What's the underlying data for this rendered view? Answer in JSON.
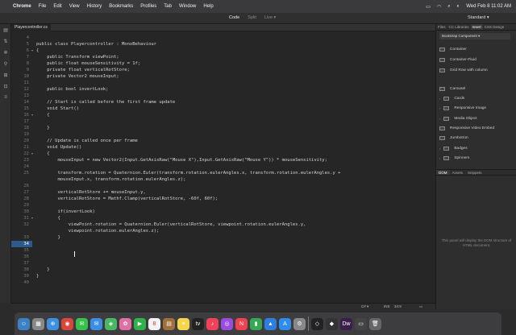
{
  "menubar": {
    "app_name": "Chrome",
    "items": [
      "File",
      "Edit",
      "View",
      "History",
      "Bookmarks",
      "Profiles",
      "Tab",
      "Window",
      "Help"
    ],
    "clock": "Wed Feb 8  11:02 AM"
  },
  "toolbar": {
    "tabs": [
      {
        "label": "Code",
        "active": true
      },
      {
        "label": "Split",
        "active": false
      },
      {
        "label": "Live ▾",
        "active": false
      }
    ],
    "workspace": "Standard ▾"
  },
  "editor": {
    "file_tab": "Playercontroller.cs",
    "current_line": "34",
    "lines": [
      {
        "n": "4",
        "fold": false,
        "t": ""
      },
      {
        "n": "5",
        "fold": false,
        "t": "public class Playercontroller : MonoBehaviour"
      },
      {
        "n": "6",
        "fold": true,
        "t": "{"
      },
      {
        "n": "7",
        "fold": false,
        "t": "    public Transform viewPoint;"
      },
      {
        "n": "8",
        "fold": false,
        "t": "    public float mouseSensitivity = 1f;"
      },
      {
        "n": "9",
        "fold": false,
        "t": "    private float verticalRotStore;"
      },
      {
        "n": "10",
        "fold": false,
        "t": "    private Vector2 mouseInput;"
      },
      {
        "n": "11",
        "fold": false,
        "t": ""
      },
      {
        "n": "12",
        "fold": false,
        "t": "    public bool invertLook;"
      },
      {
        "n": "13",
        "fold": false,
        "t": ""
      },
      {
        "n": "14",
        "fold": false,
        "t": "    // Start is called before the first frame update"
      },
      {
        "n": "15",
        "fold": false,
        "t": "    void Start()"
      },
      {
        "n": "16",
        "fold": true,
        "t": "    {"
      },
      {
        "n": "17",
        "fold": false,
        "t": ""
      },
      {
        "n": "18",
        "fold": false,
        "t": "    }"
      },
      {
        "n": "19",
        "fold": false,
        "t": ""
      },
      {
        "n": "20",
        "fold": false,
        "t": "    // Update is called once per frame"
      },
      {
        "n": "21",
        "fold": false,
        "t": "    void Update()"
      },
      {
        "n": "22",
        "fold": true,
        "t": "    {"
      },
      {
        "n": "23",
        "fold": false,
        "t": "        mouseInput = new Vector2(Input.GetAxisRaw(\"Mouse X\"),Input.GetAxisRaw(\"Mouse Y\")) * mouseSensitivity;"
      },
      {
        "n": "24",
        "fold": false,
        "t": ""
      },
      {
        "n": "25",
        "fold": false,
        "t": "        transform.rotation = Quaternion.Euler(transform.rotation.eulerAngles.x, transform.rotation.eulerAngles.y +"
      },
      {
        "n": "",
        "fold": false,
        "t": "        mouseInput.x, transform.rotation.eulerAngles.z);"
      },
      {
        "n": "26",
        "fold": false,
        "t": ""
      },
      {
        "n": "27",
        "fold": false,
        "t": "        verticalRotStore += mouseInput.y,"
      },
      {
        "n": "28",
        "fold": false,
        "t": "        verticalRotStore = Mathf.Clamp(verticalRotStore, -60f, 60f);"
      },
      {
        "n": "29",
        "fold": false,
        "t": ""
      },
      {
        "n": "30",
        "fold": false,
        "t": "        if(invertLook)"
      },
      {
        "n": "31",
        "fold": true,
        "t": "        {"
      },
      {
        "n": "32",
        "fold": false,
        "t": "            viewPoint.rotation = Quaternion.Euler(verticalRotStore, viewpoint.rotation.eulerAngles.y,"
      },
      {
        "n": "",
        "fold": false,
        "t": "            viewpoint.rotation.eulerAngles.z);"
      },
      {
        "n": "33",
        "fold": false,
        "t": "        }"
      },
      {
        "n": "34",
        "fold": false,
        "t": "        "
      },
      {
        "n": "35",
        "fold": false,
        "t": ""
      },
      {
        "n": "36",
        "fold": false,
        "t": ""
      },
      {
        "n": "37",
        "fold": false,
        "t": ""
      },
      {
        "n": "38",
        "fold": false,
        "t": "    }"
      },
      {
        "n": "39",
        "fold": false,
        "t": "}"
      },
      {
        "n": "40",
        "fold": false,
        "t": ""
      }
    ]
  },
  "statusbar": {
    "language": "C# ▾",
    "mode": "INS",
    "position": "34:9"
  },
  "right_panel": {
    "tabs": [
      {
        "label": "Files",
        "active": false
      },
      {
        "label": "CC Libraries",
        "active": false
      },
      {
        "label": "Insert",
        "active": true
      },
      {
        "label": "CSS Design",
        "active": false
      }
    ],
    "dropdown": "Bootstrap Component ▾",
    "items": [
      {
        "label": "Container",
        "arrow": false
      },
      {
        "label": "Container-Fluid",
        "arrow": false
      },
      {
        "label": "Grid Row with column",
        "arrow": false
      },
      {
        "label": "Carousel",
        "arrow": false
      },
      {
        "label": "Cards",
        "arrow": true
      },
      {
        "label": "Responsive Image",
        "arrow": true
      },
      {
        "label": "Media Object",
        "arrow": true
      },
      {
        "label": "Responsive Video Embed",
        "arrow": false
      },
      {
        "label": "Jumbotron",
        "arrow": false
      },
      {
        "label": "Badges",
        "arrow": true
      },
      {
        "label": "Spinners",
        "arrow": true
      }
    ],
    "bottom_tabs": [
      {
        "label": "DOM",
        "active": true
      },
      {
        "label": "Assets",
        "active": false
      },
      {
        "label": "Snippets",
        "active": false
      }
    ],
    "dom_message": "This panel will display the DOM structure of HTML document."
  },
  "dock": {
    "apps": [
      {
        "name": "finder",
        "color": "#3b82c4",
        "glyph": "☺"
      },
      {
        "name": "launchpad",
        "color": "#888",
        "glyph": "▦"
      },
      {
        "name": "safari",
        "color": "#3d8fe0",
        "glyph": "⊕"
      },
      {
        "name": "chrome",
        "color": "#d9463b",
        "glyph": "◉"
      },
      {
        "name": "messages",
        "color": "#37c24b",
        "glyph": "✉"
      },
      {
        "name": "mail",
        "color": "#3a8ee6",
        "glyph": "✉"
      },
      {
        "name": "maps",
        "color": "#48b863",
        "glyph": "◈"
      },
      {
        "name": "photos",
        "color": "#e06fa6",
        "glyph": "✿"
      },
      {
        "name": "facetime",
        "color": "#2fb24a",
        "glyph": "▶"
      },
      {
        "name": "calendar",
        "color": "#f2f2f2",
        "glyph": "8"
      },
      {
        "name": "finder2",
        "color": "#a0703a",
        "glyph": "▤"
      },
      {
        "name": "notes",
        "color": "#f5d64a",
        "glyph": "≡"
      },
      {
        "name": "tv",
        "color": "#222",
        "glyph": "tv"
      },
      {
        "name": "music",
        "color": "#f0405a",
        "glyph": "♪"
      },
      {
        "name": "podcasts",
        "color": "#9a4ce0",
        "glyph": "◎"
      },
      {
        "name": "news",
        "color": "#f0424f",
        "glyph": "N"
      },
      {
        "name": "numbers",
        "color": "#34a853",
        "glyph": "▮"
      },
      {
        "name": "keynote",
        "color": "#2e7de0",
        "glyph": "▲"
      },
      {
        "name": "appstore",
        "color": "#2e8cf0",
        "glyph": "A"
      },
      {
        "name": "settings",
        "color": "#888",
        "glyph": "⚙"
      },
      {
        "name": "unity",
        "color": "#222",
        "glyph": "◇"
      },
      {
        "name": "unityhub",
        "color": "#333",
        "glyph": "◆"
      },
      {
        "name": "dreamweaver",
        "color": "#3a1f4a",
        "glyph": "Dw"
      },
      {
        "name": "window",
        "color": "#444",
        "glyph": "▭"
      },
      {
        "name": "trash",
        "color": "#666",
        "glyph": "🗑"
      }
    ]
  }
}
